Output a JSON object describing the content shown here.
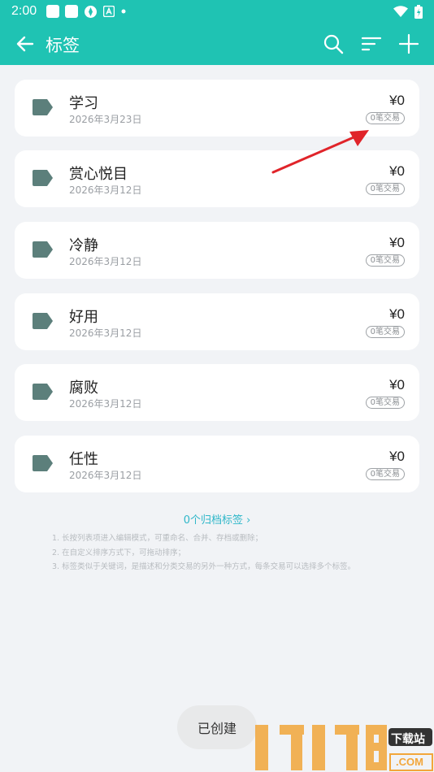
{
  "status_bar": {
    "time": "2:00"
  },
  "app_bar": {
    "title": "标签"
  },
  "tags": [
    {
      "name": "学习",
      "date": "2026年3月23日",
      "amount": "¥0",
      "badge": "0笔交易"
    },
    {
      "name": "赏心悦目",
      "date": "2026年3月12日",
      "amount": "¥0",
      "badge": "0笔交易"
    },
    {
      "name": "冷静",
      "date": "2026年3月12日",
      "amount": "¥0",
      "badge": "0笔交易"
    },
    {
      "name": "好用",
      "date": "2026年3月12日",
      "amount": "¥0",
      "badge": "0笔交易"
    },
    {
      "name": "腐败",
      "date": "2026年3月12日",
      "amount": "¥0",
      "badge": "0笔交易"
    },
    {
      "name": "任性",
      "date": "2026年3月12日",
      "amount": "¥0",
      "badge": "0笔交易"
    }
  ],
  "archived_link": "0个归档标签 ›",
  "hints": [
    "1. 长按列表项进入编辑模式，可重命名、合并、存档或删除；",
    "2. 在自定义排序方式下，可拖动排序；",
    "3. 标签类似于关键词，是描述和分类交易的另外一种方式，每条交易可以选择多个标签。"
  ],
  "toast": "已创建",
  "watermark": {
    "digits": "17178",
    "site": "下载站",
    "domain": ".COM"
  },
  "colors": {
    "accent": "#1fc3b3",
    "tag_icon": "#5c7f7b",
    "link": "#2fb7c9",
    "arrow": "#e0242a"
  }
}
